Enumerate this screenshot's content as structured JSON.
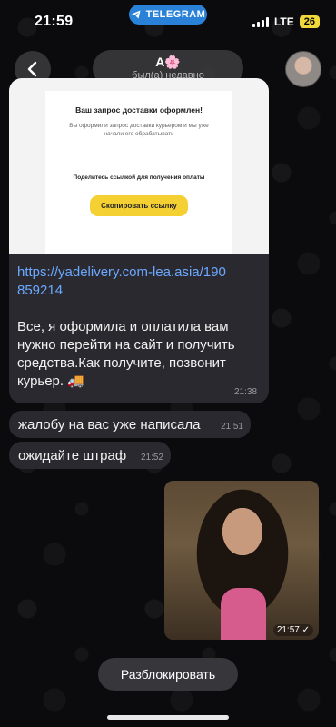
{
  "status_bar": {
    "time": "21:59",
    "app_badge": "TELEGRAM",
    "network": "LTE",
    "battery": "26"
  },
  "header": {
    "back_icon": "chevron-left-icon",
    "contact_name": "А🌸",
    "contact_status": "был(а) недавно"
  },
  "messages": {
    "screenshot": {
      "title": "Ваш запрос доставки оформлен!",
      "subtitle": "Вы оформили запрос доставки курьером и мы уже начали его обрабатывать",
      "share_text": "Поделитесь ссылкой для получения оплаты",
      "button_label": "Скопировать ссылку"
    },
    "link": "https://yadelivery.com-lea.asia/190859214",
    "main_text": "Все, я оформила и оплатила вам нужно перейти на сайт  и получить средства.Как получите, позвонит курьер. 🚚",
    "main_time": "21:38",
    "complaint_text": "жалобу на вас уже написала",
    "complaint_time": "21:51",
    "wait_text": "ожидайте штраф",
    "wait_time": "21:52",
    "photo_time": "21:57 ✓"
  },
  "actions": {
    "unblock_label": "Разблокировать"
  },
  "colors": {
    "background": "#0b0b0d",
    "bubble": "#2b2930",
    "link": "#6aa9ff",
    "telegram_badge": "#2a82d8",
    "battery": "#f0d73a",
    "screenshot_button": "#f5d033"
  }
}
